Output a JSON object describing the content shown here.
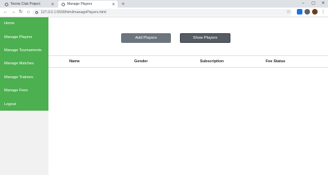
{
  "browser": {
    "tabs": [
      {
        "label": "Tennis Club Project"
      },
      {
        "label": "Manage Players"
      }
    ],
    "address": "127.0.0.1:5500/html/managePlayers.html"
  },
  "sidebar": {
    "items": [
      {
        "label": "Home"
      },
      {
        "label": "Manage Players"
      },
      {
        "label": "Manage Tournaments"
      },
      {
        "label": "Manage Matches"
      },
      {
        "label": "Manage Trainers"
      },
      {
        "label": "Manage Fees"
      },
      {
        "label": "Logout"
      }
    ]
  },
  "actions": {
    "add_label": "Add Players",
    "show_label": "Show Players"
  },
  "table": {
    "columns": [
      "Name",
      "Gender",
      "Subscription",
      "Fee Status"
    ]
  },
  "colors": {
    "sidebar_green": "#4caf50",
    "button_gray": "#6c757d"
  }
}
